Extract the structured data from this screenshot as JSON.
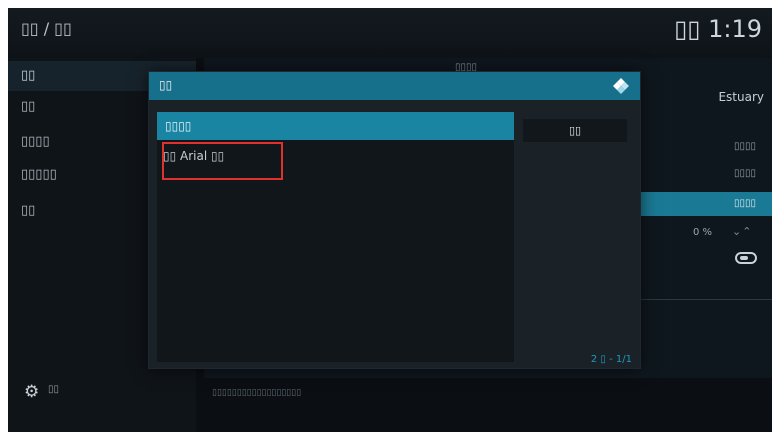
{
  "header": {
    "breadcrumb": "▯▯ / ▯▯",
    "clock": "▯▯ 1:19"
  },
  "sidebar": {
    "items": [
      {
        "label": "▯▯"
      },
      {
        "label": "▯▯"
      },
      {
        "label": "▯▯▯▯"
      },
      {
        "label": "▯▯▯▯▯"
      },
      {
        "label": "▯▯"
      }
    ],
    "footer_label": "▯▯"
  },
  "background": {
    "header_text": "▯▯▯▯",
    "skin_value": "Estuary",
    "rows": [
      "▯▯▯▯",
      "▯▯▯▯",
      "▯▯▯▯"
    ],
    "percent": "0 %",
    "arrows": "⌄⌃",
    "footer_note": "▯▯▯▯▯▯▯▯▯▯▯▯▯▯▯▯▯▯"
  },
  "dialog": {
    "title": "▯▯",
    "items": [
      {
        "label": "▯▯▯▯"
      },
      {
        "label": "▯▯ Arial ▯▯"
      }
    ],
    "side_button_label": "▯▯",
    "page_count": "2 ▯ - 1/1"
  },
  "colors": {
    "accent": "#1a84a3",
    "header": "#166f8b",
    "highlight_border": "#e0312f"
  },
  "icons": {
    "logo": "kodi-logo-icon",
    "footer": "gear-icon"
  }
}
